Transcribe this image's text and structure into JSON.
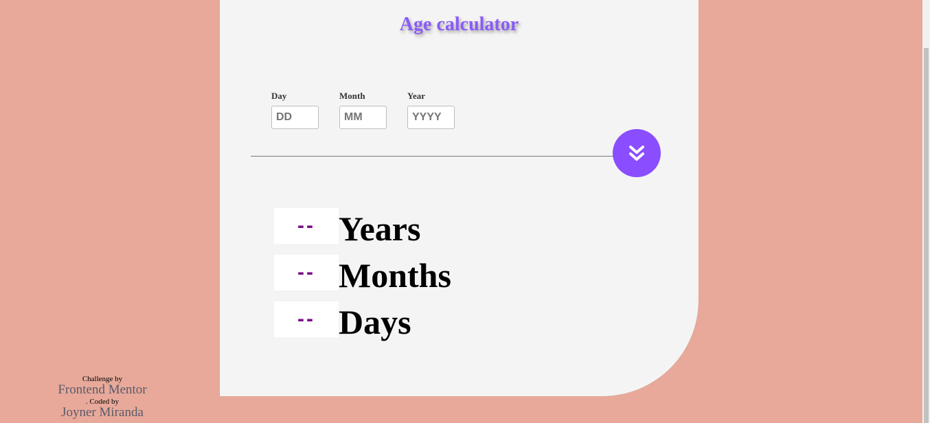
{
  "app": {
    "title": "Age calculator"
  },
  "form": {
    "day": {
      "label": "Day",
      "placeholder": "DD",
      "value": ""
    },
    "month": {
      "label": "Month",
      "placeholder": "MM",
      "value": ""
    },
    "year": {
      "label": "Year",
      "placeholder": "YYYY",
      "value": ""
    },
    "submit_icon": "double-chevron-down-icon"
  },
  "results": [
    {
      "value": "--",
      "label": "Years"
    },
    {
      "value": "--",
      "label": "Months"
    },
    {
      "value": "--",
      "label": "Days"
    }
  ],
  "attribution": {
    "challenge_text": "Challenge by",
    "challenge_link": "Frontend Mentor",
    "coded_text": ". Coded by",
    "author_link": "Joyner Miranda"
  },
  "colors": {
    "background": "#e8a99a",
    "card": "#f4f4f4",
    "accent": "#8a4dff",
    "result_value": "#7a0f86"
  }
}
